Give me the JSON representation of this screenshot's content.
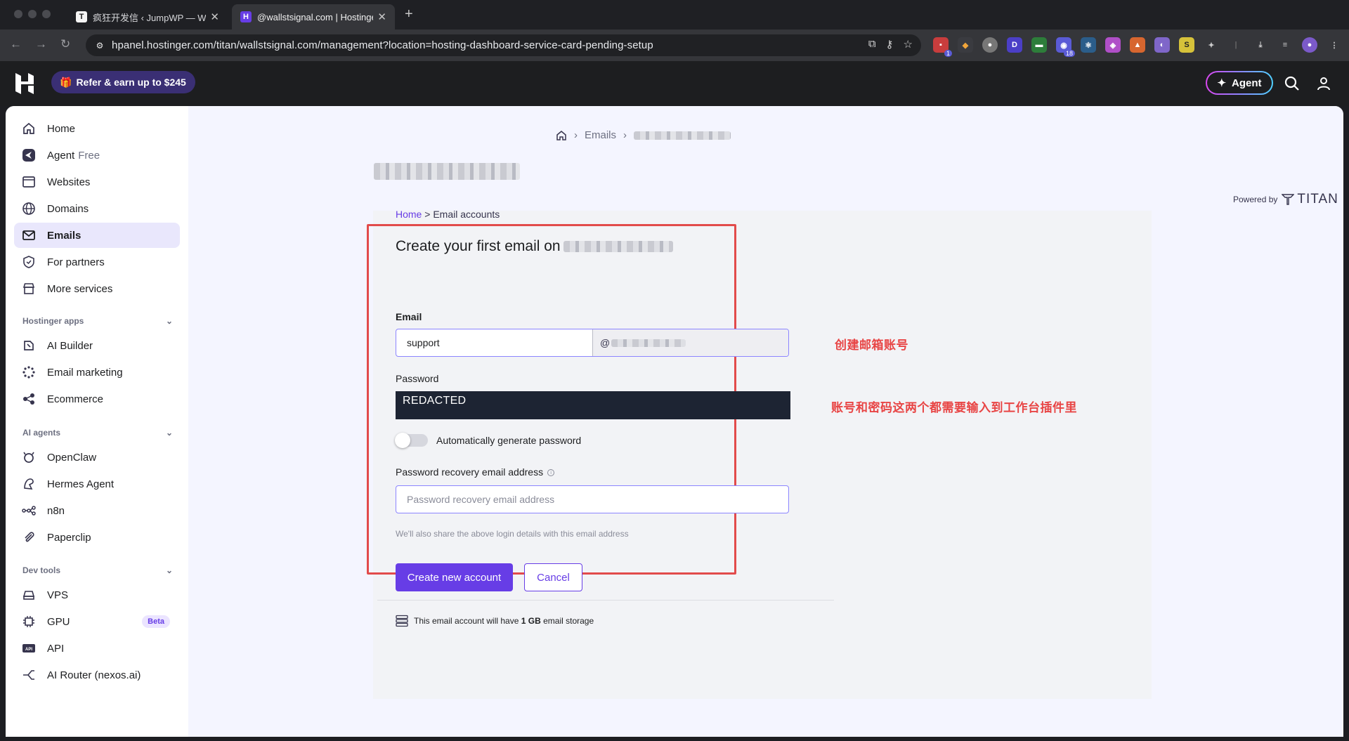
{
  "browser": {
    "tabs": [
      {
        "title": "疯狂开发信 ‹ JumpWP — Wor",
        "favicon_letter": "T",
        "active": false
      },
      {
        "title": "@wallstsignal.com | Hostinge",
        "favicon_letter": "H",
        "active": true
      }
    ],
    "url": "hpanel.hostinger.com/titan/wallstsignal.com/management?location=hosting-dashboard-service-card-pending-setup",
    "extension_badges": {
      "first": "1",
      "second": "18"
    }
  },
  "header": {
    "refer_label": "Refer & earn up to $245",
    "agent_label": "Agent"
  },
  "sidebar": {
    "items": [
      {
        "label": "Home",
        "icon": "home-icon"
      },
      {
        "label": "Agent",
        "extra": "Free",
        "icon": "agent-icon"
      },
      {
        "label": "Websites",
        "icon": "websites-icon"
      },
      {
        "label": "Domains",
        "icon": "globe-icon"
      },
      {
        "label": "Emails",
        "icon": "mail-icon",
        "active": true
      },
      {
        "label": "For partners",
        "icon": "partners-icon"
      },
      {
        "label": "More services",
        "icon": "store-icon"
      }
    ],
    "sections": [
      {
        "title": "Hostinger apps",
        "items": [
          {
            "label": "AI Builder",
            "icon": "ai-builder-icon"
          },
          {
            "label": "Email marketing",
            "icon": "email-marketing-icon"
          },
          {
            "label": "Ecommerce",
            "icon": "ecommerce-icon"
          }
        ]
      },
      {
        "title": "AI agents",
        "items": [
          {
            "label": "OpenClaw",
            "icon": "openclaw-icon"
          },
          {
            "label": "Hermes Agent",
            "icon": "hermes-icon"
          },
          {
            "label": "n8n",
            "icon": "n8n-icon"
          },
          {
            "label": "Paperclip",
            "icon": "paperclip-icon"
          }
        ]
      },
      {
        "title": "Dev tools",
        "items": [
          {
            "label": "VPS",
            "icon": "vps-icon"
          },
          {
            "label": "GPU",
            "icon": "gpu-icon",
            "badge": "Beta"
          },
          {
            "label": "API",
            "icon": "api-icon"
          },
          {
            "label": "AI Router (nexos.ai)",
            "icon": "ai-router-icon"
          }
        ]
      }
    ]
  },
  "breadcrumb": {
    "emails": "Emails"
  },
  "powered_by": {
    "label": "Powered by",
    "brand": "TITAN"
  },
  "form": {
    "crumb_home": "Home",
    "crumb_sep": ">",
    "crumb_current": "Email accounts",
    "title": "Create your first email on",
    "email_label": "Email",
    "email_user_value": "support",
    "email_at": "@",
    "password_label": "Password",
    "password_value": "REDACTED",
    "toggle_label": "Automatically generate password",
    "toggle_on": false,
    "recovery_label": "Password recovery email address",
    "recovery_placeholder": "Password recovery email address",
    "hint": "We'll also share the above login details with this email address",
    "create_button": "Create new account",
    "cancel_button": "Cancel",
    "storage_pre": "This email account will have",
    "storage_amount": "1 GB",
    "storage_post": "email storage"
  },
  "annotations": {
    "note1": "创建邮箱账号",
    "note2": "账号和密码这两个都需要输入到工作台插件里"
  },
  "colors": {
    "accent": "#673de6",
    "annotation_red": "#e84545",
    "header_bg": "#1d1e20"
  }
}
